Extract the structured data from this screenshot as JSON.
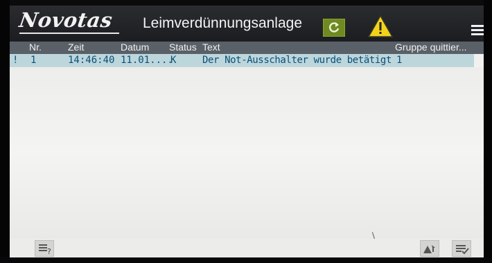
{
  "header": {
    "logo": "Novotas",
    "title": "Leimverdünnungsanlage",
    "icons": [
      "refresh-icon",
      "warning-icon",
      "menu-icon"
    ]
  },
  "table": {
    "columns": [
      "Nr.",
      "Zeit",
      "Datum",
      "Status",
      "Text",
      "Gruppe quittier..."
    ],
    "rows": [
      {
        "marker": "!",
        "nr": "1",
        "zeit": "14:46:40",
        "datum": "11.01....",
        "status": "K",
        "text": "Der Not-Ausschalter wurde betätigt",
        "gruppe": "1"
      }
    ]
  },
  "footer": {
    "icons": [
      "help-list-icon",
      "acknowledge-alarm-icon",
      "acknowledge-list-icon"
    ]
  },
  "colors": {
    "header_bg": "#1c1d20",
    "column_header_bg": "#596067",
    "row_highlight": "#bcd6dc",
    "row_text": "#0b4f76",
    "refresh_green": "#6f8a1f",
    "warning_yellow": "#f3d21a"
  }
}
